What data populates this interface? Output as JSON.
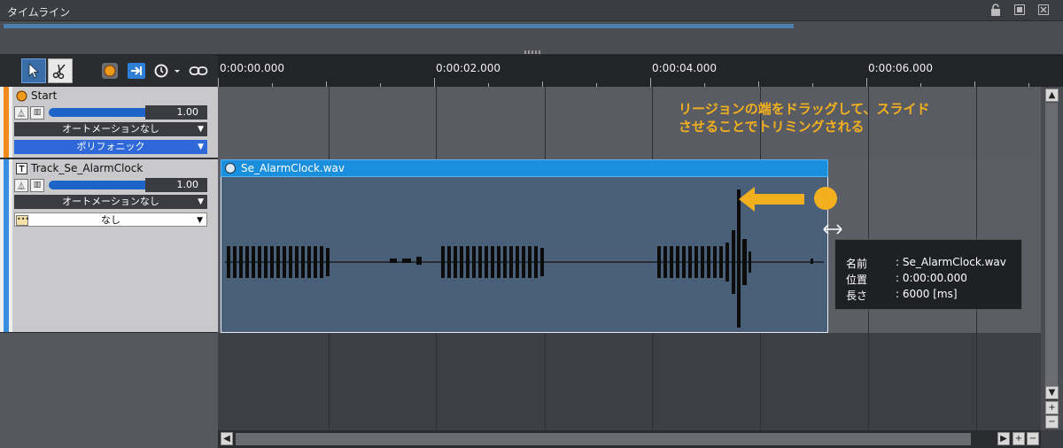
{
  "window": {
    "title": "タイムライン",
    "icons": [
      "lock-icon",
      "maximize-icon",
      "close-icon"
    ]
  },
  "toolbar": {
    "tools": [
      "select-arrow-icon",
      "scissors-icon",
      "record-icon",
      "next-icon",
      "clock-icon",
      "link-icon"
    ]
  },
  "ruler": {
    "labels": [
      "0:00:00.000",
      "0:00:02.000",
      "0:00:04.000",
      "0:00:06.000"
    ]
  },
  "tracks": [
    {
      "name": "Start",
      "color": "#f08a1c",
      "volume": "1.00",
      "volume_level": 1.0,
      "automation": "オートメーションなし",
      "mode": "ポリフォニック"
    },
    {
      "name": "Track_Se_AlarmClock",
      "color": "#3a8ee0",
      "volume": "1.00",
      "volume_level": 1.0,
      "automation": "オートメーションなし",
      "mode": "なし"
    }
  ],
  "region": {
    "name": "Se_AlarmClock.wav",
    "color": "#1a8fdd"
  },
  "annotation": {
    "line1": "リージョンの端をドラッグして、スライド",
    "line2": "させることでトリミングされる",
    "color": "#f2b01e"
  },
  "tooltip": {
    "rows": [
      {
        "key": "名前",
        "value": ": Se_AlarmClock.wav"
      },
      {
        "key": "位置",
        "value": ": 0:00:00.000"
      },
      {
        "key": "長さ",
        "value": ": 6000 [ms]"
      }
    ]
  }
}
